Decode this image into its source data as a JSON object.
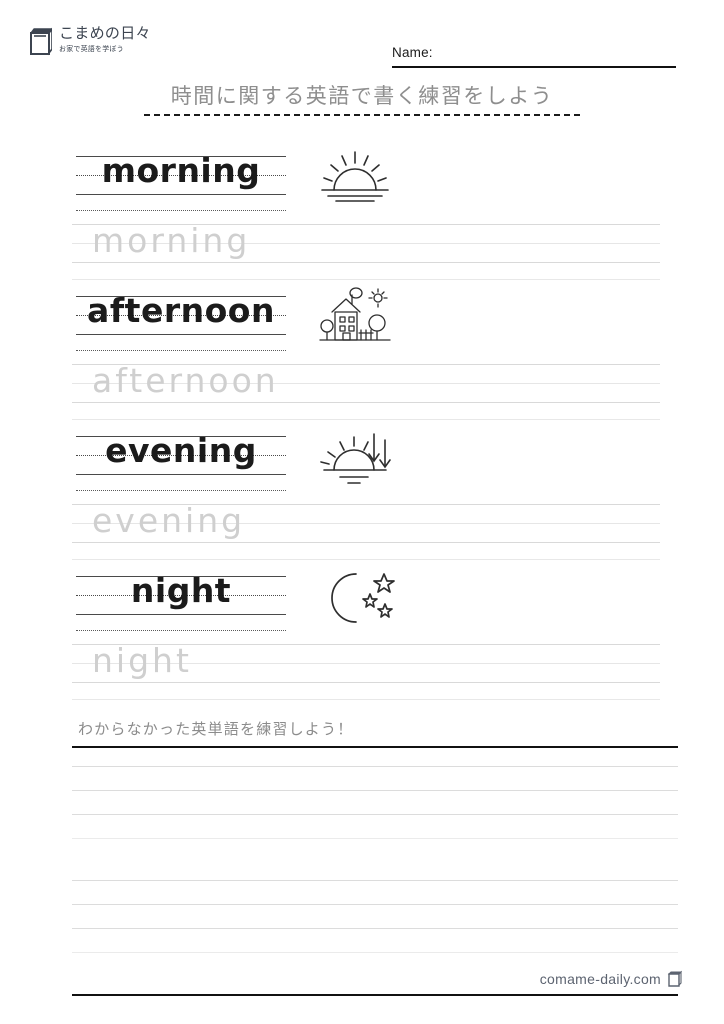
{
  "brand": {
    "title": "こまめの日々",
    "subtitle": "お家で英語を学ぼう",
    "icon": "book-icon"
  },
  "name_field": {
    "label": "Name:",
    "value": ""
  },
  "title": {
    "text": "時間に関する英語で書く練習をしよう"
  },
  "practice_rows": [
    {
      "word": "morning",
      "style": "dark",
      "icon": "sunrise-icon"
    },
    {
      "word": "morning",
      "style": "trace",
      "icon": ""
    },
    {
      "word": "afternoon",
      "style": "dark",
      "icon": "house-daytime-icon"
    },
    {
      "word": "afternoon",
      "style": "trace",
      "icon": ""
    },
    {
      "word": "evening",
      "style": "dark",
      "icon": "sunset-icon"
    },
    {
      "word": "evening",
      "style": "trace",
      "icon": ""
    },
    {
      "word": "night",
      "style": "dark",
      "icon": "moon-stars-icon"
    },
    {
      "word": "night",
      "style": "trace",
      "icon": ""
    }
  ],
  "free_write": {
    "note": "わからなかった英単語を練習しよう！",
    "group_count": 2,
    "lines_per_group": 4
  },
  "footer": {
    "site": "comame-daily.com",
    "icon": "book-icon"
  },
  "colors": {
    "ink": "#1b1b1b",
    "guide_dark": "#4a4a4a",
    "guide_light": "#d9d9d9",
    "trace_text": "#cfcfcf",
    "title_gray": "#8e8e8e",
    "brand": "#3c4450",
    "footer": "#5c6370"
  }
}
